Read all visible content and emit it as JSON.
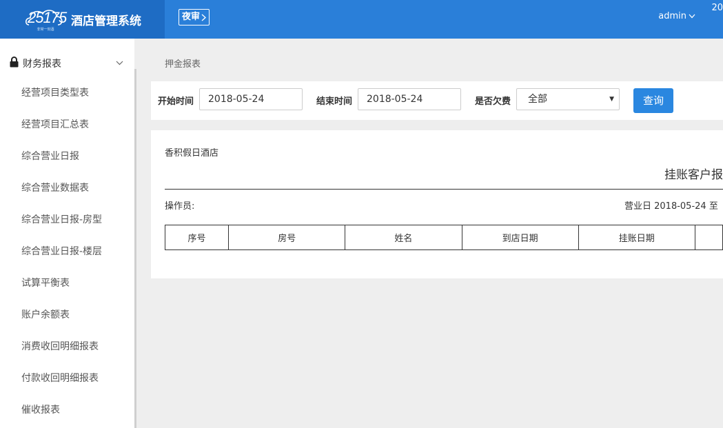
{
  "header": {
    "logo_number": "25175",
    "logo_tagline": "非常一刻酒",
    "app_title": "酒店管理系统",
    "night_audit_label": "夜审",
    "user_name": "admin",
    "corner_text": "20"
  },
  "sidebar": {
    "group_label": "财务报表",
    "items": [
      {
        "label": "经营项目类型表"
      },
      {
        "label": "经营项目汇总表"
      },
      {
        "label": "综合营业日报"
      },
      {
        "label": "综合营业数据表"
      },
      {
        "label": "综合营业日报-房型"
      },
      {
        "label": "综合营业日报-楼层"
      },
      {
        "label": "试算平衡表"
      },
      {
        "label": "账户余额表"
      },
      {
        "label": "消费收回明细报表"
      },
      {
        "label": "付款收回明细报表"
      },
      {
        "label": "催收报表"
      }
    ]
  },
  "main": {
    "breadcrumb": "押金报表",
    "filter": {
      "start_label": "开始时间",
      "start_value": "2018-05-24",
      "end_label": "结束时间",
      "end_value": "2018-05-24",
      "arrears_label": "是否欠费",
      "arrears_value": "全部",
      "query_label": "查询"
    },
    "report": {
      "hotel_name": "香积假日酒店",
      "title": "挂账客户报",
      "operator_label": "操作员:",
      "business_day": "营业日 2018-05-24 至",
      "columns": [
        "序号",
        "房号",
        "姓名",
        "到店日期",
        "挂账日期"
      ]
    }
  },
  "colors": {
    "header_bg": "#2a7fd9",
    "brand_bg": "#1e6cc4",
    "button_bg": "#2a87e0"
  }
}
